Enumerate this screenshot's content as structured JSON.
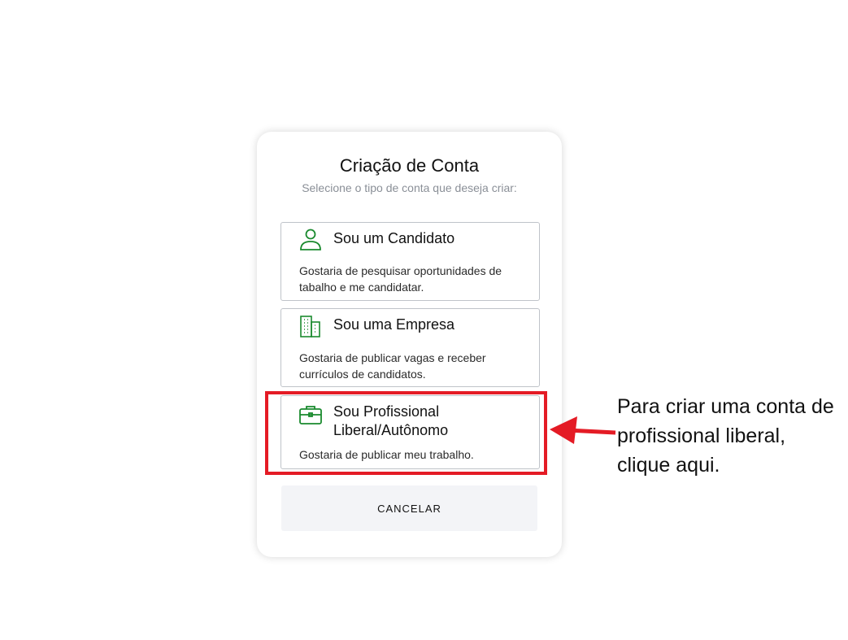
{
  "dialog": {
    "title": "Criação de Conta",
    "subtitle": "Selecione o tipo de conta que deseja criar:",
    "options": [
      {
        "icon": "person-icon",
        "title": "Sou um Candidato",
        "description": "Gostaria de pesquisar oportunidades de tabalho e me candidatar."
      },
      {
        "icon": "building-icon",
        "title": "Sou uma Empresa",
        "description": "Gostaria de publicar vagas e receber currículos de candidatos."
      },
      {
        "icon": "briefcase-icon",
        "title": "Sou Profissional Liberal/Autônomo",
        "description": "Gostaria de publicar meu trabalho."
      }
    ],
    "cancel_label": "CANCELAR"
  },
  "annotation": {
    "text": "Para criar uma conta de profissional liberal, clique aqui."
  },
  "colors": {
    "icon_green": "#1a8a2e",
    "highlight_red": "#e41b25"
  }
}
